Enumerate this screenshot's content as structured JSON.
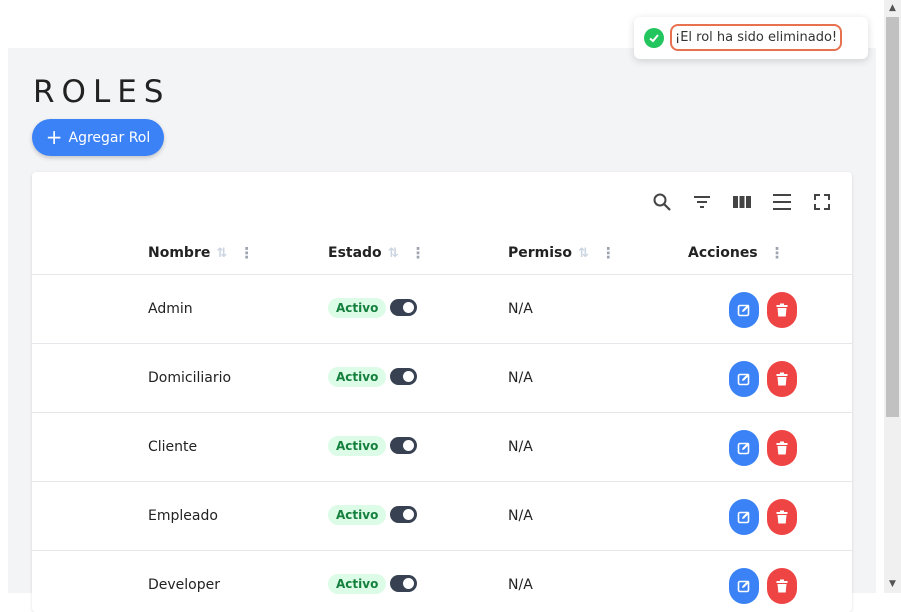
{
  "toast": {
    "message": "¡El rol ha sido eliminado!"
  },
  "page": {
    "title": "ROLES",
    "add_button_label": "Agregar Rol"
  },
  "toolbar": {
    "icons": [
      "search-icon",
      "filter-icon",
      "columns-icon",
      "density-icon",
      "fullscreen-icon"
    ]
  },
  "table": {
    "columns": {
      "name": "Nombre",
      "status": "Estado",
      "permission": "Permiso",
      "actions": "Acciones"
    },
    "rows": [
      {
        "name": "Admin",
        "status": "Activo",
        "permission": "N/A"
      },
      {
        "name": "Domiciliario",
        "status": "Activo",
        "permission": "N/A"
      },
      {
        "name": "Cliente",
        "status": "Activo",
        "permission": "N/A"
      },
      {
        "name": "Empleado",
        "status": "Activo",
        "permission": "N/A"
      },
      {
        "name": "Developer",
        "status": "Activo",
        "permission": "N/A"
      }
    ]
  },
  "colors": {
    "primary": "#3b82f6",
    "danger": "#ef4444",
    "success": "#22c55e",
    "toast_outline": "#e8724f"
  }
}
